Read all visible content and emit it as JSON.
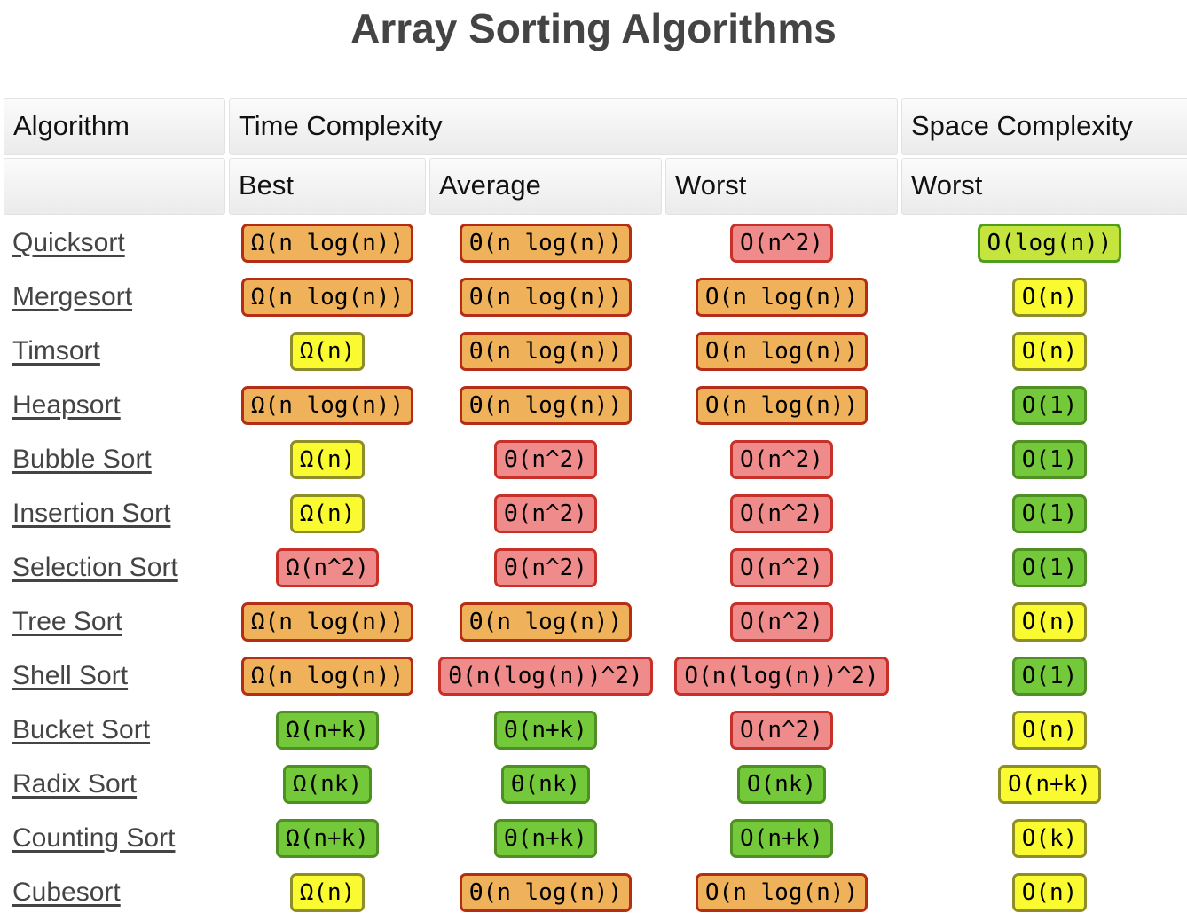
{
  "page": {
    "title": "Array Sorting Algorithms"
  },
  "table": {
    "header_group": {
      "algorithm": "Algorithm",
      "time_complexity": "Time Complexity",
      "space_complexity": "Space Complexity"
    },
    "header_sub": {
      "algorithm": "",
      "best": "Best",
      "average": "Average",
      "worst": "Worst",
      "space_worst": "Worst"
    },
    "rows": [
      {
        "algorithm": "Quicksort",
        "best": {
          "text": "Ω(n log(n))",
          "severity": "orange"
        },
        "average": {
          "text": "Θ(n log(n))",
          "severity": "orange"
        },
        "worst": {
          "text": "O(n^2)",
          "severity": "red"
        },
        "space": {
          "text": "O(log(n))",
          "severity": "yellowgreen"
        }
      },
      {
        "algorithm": "Mergesort",
        "best": {
          "text": "Ω(n log(n))",
          "severity": "orange"
        },
        "average": {
          "text": "Θ(n log(n))",
          "severity": "orange"
        },
        "worst": {
          "text": "O(n log(n))",
          "severity": "orange"
        },
        "space": {
          "text": "O(n)",
          "severity": "yellow"
        }
      },
      {
        "algorithm": "Timsort",
        "best": {
          "text": "Ω(n)",
          "severity": "yellow"
        },
        "average": {
          "text": "Θ(n log(n))",
          "severity": "orange"
        },
        "worst": {
          "text": "O(n log(n))",
          "severity": "orange"
        },
        "space": {
          "text": "O(n)",
          "severity": "yellow"
        }
      },
      {
        "algorithm": "Heapsort",
        "best": {
          "text": "Ω(n log(n))",
          "severity": "orange"
        },
        "average": {
          "text": "Θ(n log(n))",
          "severity": "orange"
        },
        "worst": {
          "text": "O(n log(n))",
          "severity": "orange"
        },
        "space": {
          "text": "O(1)",
          "severity": "green"
        }
      },
      {
        "algorithm": "Bubble Sort",
        "best": {
          "text": "Ω(n)",
          "severity": "yellow"
        },
        "average": {
          "text": "Θ(n^2)",
          "severity": "red"
        },
        "worst": {
          "text": "O(n^2)",
          "severity": "red"
        },
        "space": {
          "text": "O(1)",
          "severity": "green"
        }
      },
      {
        "algorithm": "Insertion Sort",
        "best": {
          "text": "Ω(n)",
          "severity": "yellow"
        },
        "average": {
          "text": "Θ(n^2)",
          "severity": "red"
        },
        "worst": {
          "text": "O(n^2)",
          "severity": "red"
        },
        "space": {
          "text": "O(1)",
          "severity": "green"
        }
      },
      {
        "algorithm": "Selection Sort",
        "best": {
          "text": "Ω(n^2)",
          "severity": "red"
        },
        "average": {
          "text": "Θ(n^2)",
          "severity": "red"
        },
        "worst": {
          "text": "O(n^2)",
          "severity": "red"
        },
        "space": {
          "text": "O(1)",
          "severity": "green"
        }
      },
      {
        "algorithm": "Tree Sort",
        "best": {
          "text": "Ω(n log(n))",
          "severity": "orange"
        },
        "average": {
          "text": "Θ(n log(n))",
          "severity": "orange"
        },
        "worst": {
          "text": "O(n^2)",
          "severity": "red"
        },
        "space": {
          "text": "O(n)",
          "severity": "yellow"
        }
      },
      {
        "algorithm": "Shell Sort",
        "best": {
          "text": "Ω(n log(n))",
          "severity": "orange"
        },
        "average": {
          "text": "Θ(n(log(n))^2)",
          "severity": "red"
        },
        "worst": {
          "text": "O(n(log(n))^2)",
          "severity": "red"
        },
        "space": {
          "text": "O(1)",
          "severity": "green"
        }
      },
      {
        "algorithm": "Bucket Sort",
        "best": {
          "text": "Ω(n+k)",
          "severity": "green"
        },
        "average": {
          "text": "Θ(n+k)",
          "severity": "green"
        },
        "worst": {
          "text": "O(n^2)",
          "severity": "red"
        },
        "space": {
          "text": "O(n)",
          "severity": "yellow"
        }
      },
      {
        "algorithm": "Radix Sort",
        "best": {
          "text": "Ω(nk)",
          "severity": "green"
        },
        "average": {
          "text": "Θ(nk)",
          "severity": "green"
        },
        "worst": {
          "text": "O(nk)",
          "severity": "green"
        },
        "space": {
          "text": "O(n+k)",
          "severity": "yellow"
        }
      },
      {
        "algorithm": "Counting Sort",
        "best": {
          "text": "Ω(n+k)",
          "severity": "green"
        },
        "average": {
          "text": "Θ(n+k)",
          "severity": "green"
        },
        "worst": {
          "text": "O(n+k)",
          "severity": "green"
        },
        "space": {
          "text": "O(k)",
          "severity": "yellow"
        }
      },
      {
        "algorithm": "Cubesort",
        "best": {
          "text": "Ω(n)",
          "severity": "yellow"
        },
        "average": {
          "text": "Θ(n log(n))",
          "severity": "orange"
        },
        "worst": {
          "text": "O(n log(n))",
          "severity": "orange"
        },
        "space": {
          "text": "O(n)",
          "severity": "yellow"
        }
      }
    ]
  },
  "legend_colors": {
    "orange_fill": "#efb25b",
    "orange_border": "#b62d15",
    "red_fill": "#ef8b8b",
    "red_border": "#c8312a",
    "yellow_fill": "#fafa30",
    "yellow_border": "#8d8d2a",
    "yellowgreen_fill": "#c5e43e",
    "yellowgreen_border": "#4f9e1e",
    "green_fill": "#74c93a",
    "green_border": "#4f8f24",
    "title_color": "#444444",
    "header_bg": "#f2f2f2"
  }
}
